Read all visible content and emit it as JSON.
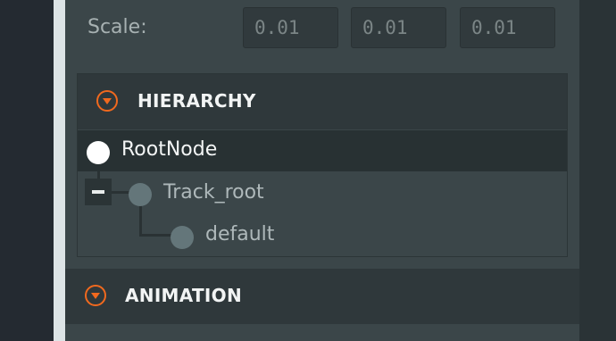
{
  "transform": {
    "scale_label": "Scale:",
    "scale_x": "0.01",
    "scale_y": "0.01",
    "scale_z": "0.01"
  },
  "hierarchy": {
    "title": "HIERARCHY",
    "icon": "chevron-down-circle-icon",
    "nodes": [
      {
        "label": "RootNode",
        "selected": true
      },
      {
        "label": "Track_root",
        "expanded": true
      },
      {
        "label": "default"
      }
    ]
  },
  "animation": {
    "title": "ANIMATION",
    "icon": "chevron-down-circle-icon"
  },
  "colors": {
    "accent": "#f1691e",
    "panel_bg": "#3b4649",
    "header_bg": "#2f383b",
    "selected_row": "#283133"
  }
}
